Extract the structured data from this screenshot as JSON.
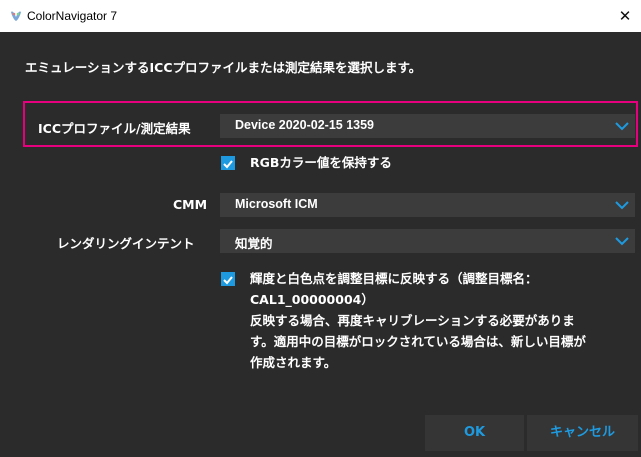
{
  "window": {
    "title": "ColorNavigator 7",
    "close_glyph": "✕",
    "app_icon": "colornavigator-icon"
  },
  "instruction": "エミュレーションするICCプロファイルまたは測定結果を選択します。",
  "fields": {
    "profile": {
      "label": "ICCプロファイル/測定結果",
      "value": "Device 2020-02-15 1359"
    },
    "keep_rgb": {
      "label": "RGBカラー値を保持する",
      "checked": true
    },
    "cmm": {
      "label": "CMM",
      "value": "Microsoft ICM"
    },
    "intent": {
      "label": "レンダリングインテント",
      "value": "知覚的"
    },
    "reflect": {
      "checked": true,
      "line1": "輝度と白色点を調整目標に反映する（調整目標名：",
      "line2": "CAL1_00000004）",
      "note1": "反映する場合、再度キャリブレーションする必要がありま",
      "note2": "す。適用中の目標がロックされている場合は、新しい目標が",
      "note3": "作成されます。"
    }
  },
  "buttons": {
    "ok": "OK",
    "cancel": "キャンセル"
  },
  "colors": {
    "accent": "#1e9be0",
    "highlight": "#e6007e",
    "background": "#2b2b2b",
    "field": "#3c3c3c"
  }
}
